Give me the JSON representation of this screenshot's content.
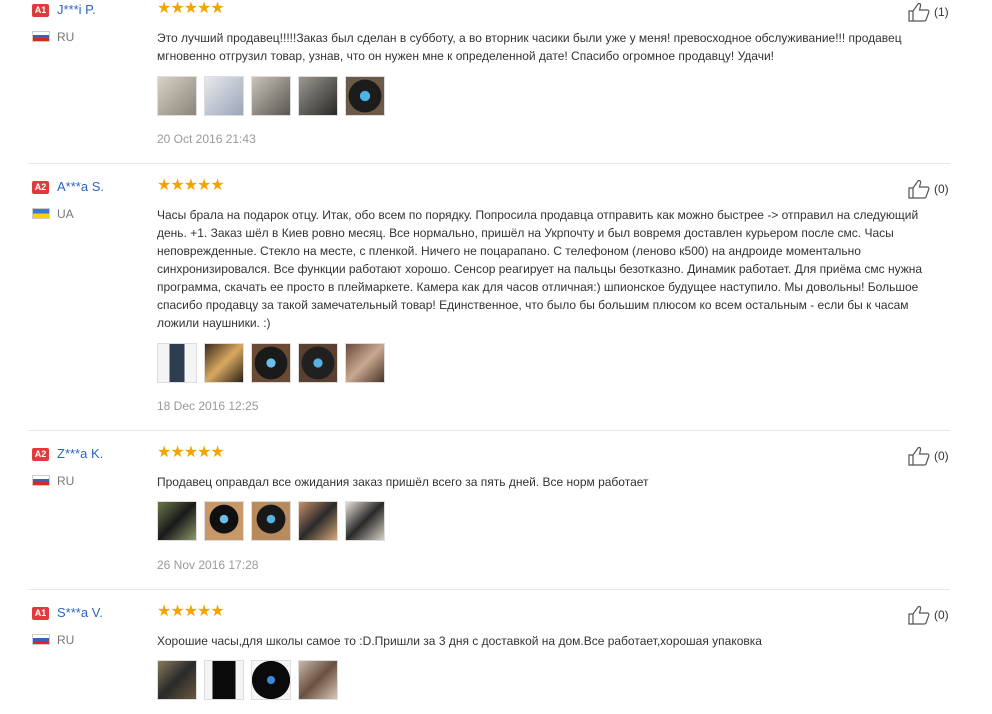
{
  "reviews": [
    {
      "badge": "A1",
      "name": "J***i P.",
      "country": "RU",
      "stars": "★★★★★",
      "helpful": "(1)",
      "text": "Это лучший продавец!!!!!Заказ был сделан в субботу, а во вторник часики были уже у меня! превосходное обслуживание!!! продавец мгновенно отгрузил товар, узнав, что он нужен мне к определенной дате! Спасибо огромное продавцу! Удачи!",
      "date": "20 Oct 2016 21:43"
    },
    {
      "badge": "A2",
      "name": "A***a S.",
      "country": "UA",
      "stars": "★★★★★",
      "helpful": "(0)",
      "text": "Часы брала на подарок отцу. Итак, обо всем по порядку. Попросила продавца отправить как можно быстрее -> отправил на следующий день. +1. Заказ шёл в Киев ровно месяц. Все нормально, пришёл на Укрпочту и был вовремя доставлен курьером после смс. Часы неповрежденные. Стекло на месте, с пленкой. Ничего не поцарапано. С телефоном (леново к500) на андроиде моментально синхронизировался. Все функции работают хорошо. Сенсор реагирует на пальцы безотказно. Динамик работает. Для приёма смс нужна программа, скачать ее просто в плеймаркете. Камера как для часов отличная:) шпионское будущее наступило. Мы довольны! Большое спасибо продавцу за такой замечательный товар! Единственное, что было бы большим плюсом ко всем остальным - если бы к часам ложили наушники. :)",
      "date": "18 Dec 2016 12:25"
    },
    {
      "badge": "A2",
      "name": "Z***a K.",
      "country": "RU",
      "stars": "★★★★★",
      "helpful": "(0)",
      "text": "Продавец оправдал все ожидания заказ пришёл всего за пять дней. Все норм работает",
      "date": "26 Nov 2016 17:28"
    },
    {
      "badge": "A1",
      "name": "S***a V.",
      "country": "RU",
      "stars": "★★★★★",
      "helpful": "(0)",
      "text": "Хорошие часы,для школы самое то :D.Пришли за 3 дня с доставкой на дом.Все работает,хорошая упаковка",
      "date": ""
    }
  ],
  "icons": {
    "thumb_up": "thumbs-up-icon"
  },
  "colors": {
    "badge": "#e4393c",
    "stars": "#f4a300",
    "name": "#2b65c1"
  }
}
